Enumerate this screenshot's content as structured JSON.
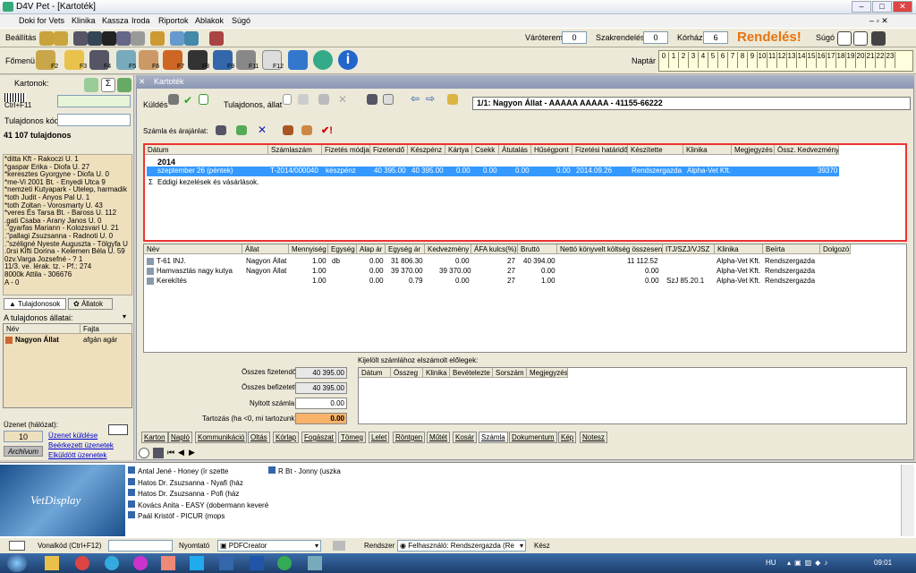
{
  "app": {
    "title": "D4V Pet - [Kartoték]"
  },
  "menu": [
    "Doki for Vets",
    "Klinika",
    "Kassza",
    "Iroda",
    "Riportok",
    "Ablakok",
    "Súgó"
  ],
  "toolbar1": {
    "beallitas": "Beállítás",
    "varoterem_label": "Váróterem",
    "varoterem_value": "0",
    "szakrendeles_label": "Szakrendelés",
    "szakrendeles_value": "0",
    "korhaz_label": "Kórház",
    "korhaz_value": "6",
    "rendeles": "Rendelés!",
    "sugo": "Súgó"
  },
  "toolbar2": {
    "fomenu": "Főmenü",
    "fkeys": [
      "F2",
      "F3",
      "F4",
      "F5",
      "F6",
      "F7",
      "F8",
      "F9",
      "F11",
      "F12"
    ],
    "naptar": "Naptár",
    "days": [
      "0",
      "1",
      "2",
      "3",
      "4",
      "5",
      "6",
      "7",
      "8",
      "9",
      "10",
      "11",
      "12",
      "13",
      "14",
      "15",
      "16",
      "17",
      "18",
      "19",
      "20",
      "21",
      "22",
      "23"
    ]
  },
  "left": {
    "kartonok": "Kartonok:",
    "ctrl": "Ctrl+F11",
    "tulajdonos_kod": "Tulajdonos kód:",
    "count": "41 107 tulajdonos",
    "owners": [
      "*ditta Kft - Rakoczi U. 1",
      "*gaspar Erika - Diofa U. 27",
      "*keresztes Gyorgyne - Diofa U. 0",
      "*me-Vi 2001 Bt. - Enyedi Utca 9",
      "*nemzeti Kutyapark - Utelep, harmadik",
      "*toth Judit - Anyos Pal U. 1",
      "*toth Zoltan - Vorosmarty U. 43",
      "*veres És Tarsa Bt. - Baross U. 112",
      ".gati Csaba - Arany Janos U. 0",
      ".\"gyarfas Mariann - Kolozsvari U. 21",
      ".\"pallagi Zsuzsanna - Radnoti U. 0",
      ".\"széligné Nyeste Auguszta - Tölgyfa U",
      ".0rsi Kifti Dorina - Kelemen Béla U. 59",
      "0zv.Varga Jozsefné - ? 1",
      "11/3. ve. lérak. tz. - Pf.: 274",
      "8000k Attila - 306676",
      "A - 0"
    ],
    "tab_owners": "Tulajdonosok",
    "tab_animals": "Állatok",
    "animals_label": "A tulajdonos állatai:",
    "col_nev": "Név",
    "col_fajta": "Fajta",
    "animal_name": "Nagyon Állat",
    "animal_breed": "afgán agár",
    "uzenet_label": "Üzenet (hálózat):",
    "uzenet_count": "10",
    "uzenet_kuldese": "Üzenet küldése",
    "beerkezett": "Beérkezett üzenetek",
    "elkuldott": "Elküldött üzenetek",
    "archivum": "Archívum"
  },
  "kartotek": {
    "title": "Kartoték",
    "kuldes": "Küldés",
    "tulaj_allat": "Tulajdonos, állat",
    "patient": "1/1: Nagyon Állat - AAAAA AAAAA - 41155-66222",
    "szamla_label": "Számla és árajánlat:",
    "inv_headers": [
      "Dátum",
      "Számlaszám",
      "Fizetés módja",
      "Fizetendő",
      "Készpénz",
      "Kártya",
      "Csekk",
      "Átutalás",
      "Hűségpont",
      "Fizetési határidő",
      "Készítette",
      "Klinika",
      "Megjegyzés",
      "Össz. Kedvezmény"
    ],
    "year": "2014",
    "inv_row": [
      "szeptember 26 (péntek)",
      "T-2014/000040",
      "készpénz",
      "40 395.00",
      "40 395.00",
      "0.00",
      "0.00",
      "0.00",
      "0.00",
      "2014.09.26",
      "Rendszergazda",
      "Alpha-Vet Kft.",
      "",
      "39370"
    ],
    "eddigi": "Eddigi kezelések és vásárlások.",
    "item_headers": [
      "Név",
      "Állat",
      "Mennyiség",
      "Egység",
      "Alap ár",
      "Egység ár",
      "Kedvezmény",
      "ÁFA kulcs(%)",
      "Bruttó",
      "Nettó könyvelt költség összesen",
      "ITJ/SZJ/VJSZ",
      "Klinika",
      "Beírta",
      "Dolgozó"
    ],
    "items": [
      [
        "T-61 INJ.",
        "Nagyon Állat",
        "1.00",
        "db",
        "0.00",
        "31 806.30",
        "0.00",
        "27",
        "40 394.00",
        "11 112.52",
        "",
        "Alpha-Vet Kft.",
        "Rendszergazda",
        ""
      ],
      [
        "Hamvasztás nagy kutya",
        "Nagyon Állat",
        "1.00",
        "",
        "0.00",
        "39 370.00",
        "39 370.00",
        "27",
        "0.00",
        "0.00",
        "",
        "Alpha-Vet Kft.",
        "Rendszergazda",
        ""
      ],
      [
        "Kerekítés",
        "",
        "1.00",
        "",
        "0.00",
        "0.79",
        "0.00",
        "27",
        "1.00",
        "0.00",
        "SzJ 85.20.1",
        "Alpha-Vet Kft.",
        "Rendszergazda",
        ""
      ]
    ],
    "osszes_fizetendo_label": "Összes fizetendő:",
    "osszes_fizetendo": "40 395.00",
    "osszes_befizetett_label": "Összes befizetett:",
    "osszes_befizetett": "40 395.00",
    "nyitott_label": "Nyitott számla:",
    "nyitott": "0.00",
    "tartozas_label": "Tartozás (ha <0, mi tartozunk):",
    "tartozas": "0.00",
    "elolegek_label": "Kijelölt számlához elszámolt előlegek:",
    "eloleg_headers": [
      "Dátum",
      "Összeg",
      "Klinika",
      "Bevételezte",
      "Sorszám",
      "Megjegyzés"
    ],
    "tabs": [
      "Karton",
      "Napló",
      "Kommunikáció",
      "Oltás",
      "Kórlap",
      "Fogászat",
      "Tömeg",
      "Lelet",
      "Röntgen",
      "Műtét",
      "Kosár",
      "Számla",
      "Dokumentum",
      "Kép",
      "Notesz"
    ]
  },
  "bottom": {
    "logo": "VetDisplay",
    "entries1": [
      "Antal Jené - Honey (ír szette",
      "Hatos Dr. Zsuzsanna - Nyafi (ház",
      "Hatos Dr. Zsuzsanna - Pofi (ház",
      "Kovács Anita - EASY (dobermann keveré",
      "Paál Kristóf - PICUR (mops"
    ],
    "entries2": [
      "R Bt - Jonny (uszka"
    ]
  },
  "status": {
    "vonalkod": "Vonalkód (Ctrl+F12)",
    "nyomtato": "Nyomtató",
    "printer": "PDFCreator",
    "rendszer": "Rendszer",
    "user": "Felhasználó: Rendszergazda (Re",
    "kesz": "Kész"
  },
  "taskbar": {
    "lang": "HU",
    "time": "09:01"
  }
}
